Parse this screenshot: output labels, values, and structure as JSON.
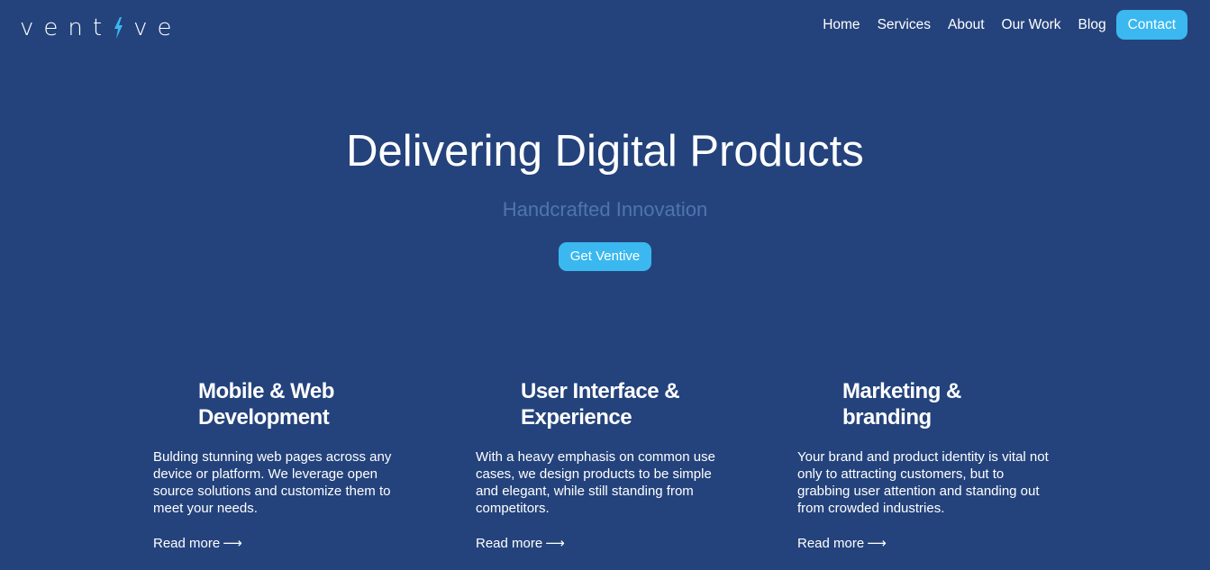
{
  "logo": {
    "text_left": "vent",
    "text_right": "ve",
    "accent_color": "#3ab8ef"
  },
  "nav": {
    "items": [
      "Home",
      "Services",
      "About",
      "Our Work",
      "Blog"
    ],
    "contact_label": "Contact"
  },
  "hero": {
    "title": "Delivering Digital Products",
    "subtitle": "Handcrafted Innovation",
    "cta_label": "Get Ventive"
  },
  "services": [
    {
      "title": "Mobile & Web Development",
      "description": "Bulding stunning web pages across any device or platform. We leverage open source solutions and customize them to meet your needs.",
      "read_more": "Read more",
      "arrow_icon": "long-arrow-right-icon"
    },
    {
      "title": "User Interface & Experience",
      "description": "With a heavy emphasis on common use cases, we design products to be simple and elegant, while still standing from competitors.",
      "read_more": "Read more",
      "arrow_icon": "long-arrow-right-icon"
    },
    {
      "title": "Marketing & branding",
      "description": "Your brand and product identity is vital not only to attracting customers, but to grabbing user attention and standing out from crowded industries.",
      "read_more": "Read more",
      "arrow_icon": "long-arrow-right-icon"
    }
  ],
  "colors": {
    "background": "#24437c",
    "accent": "#3ab8ef",
    "subtitle": "#4f75ad",
    "text": "#ffffff"
  }
}
